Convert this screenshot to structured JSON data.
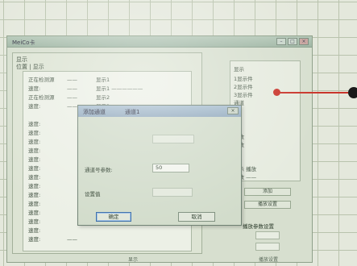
{
  "window": {
    "title": "MeiCo卡",
    "controls": [
      "–",
      "□",
      "×"
    ]
  },
  "left_panel": {
    "header": "显示",
    "subheader": "位置 | 显示",
    "rows": [
      {
        "key": "正在检测源",
        "val": "——",
        "num": "显示1"
      },
      {
        "key": "速度:",
        "val": "——",
        "num": "显示1 ——————"
      },
      {
        "key": "正在检测源",
        "val": "——",
        "num": "显示2"
      },
      {
        "key": "速度:",
        "val": "——",
        "num": "显示2"
      },
      {
        "key": "",
        "val": "",
        "num": ""
      },
      {
        "key": "速度:",
        "val": "",
        "num": ""
      },
      {
        "key": "速度:",
        "val": "",
        "num": ""
      },
      {
        "key": "速度:",
        "val": "",
        "num": ""
      },
      {
        "key": "速度:",
        "val": "",
        "num": ""
      },
      {
        "key": "速度:",
        "val": "",
        "num": ""
      },
      {
        "key": "速度:",
        "val": "",
        "num": ""
      },
      {
        "key": "速度:",
        "val": "",
        "num": ""
      },
      {
        "key": "速度:",
        "val": "",
        "num": ""
      },
      {
        "key": "速度:",
        "val": "",
        "num": ""
      },
      {
        "key": "速度:",
        "val": "",
        "num": ""
      },
      {
        "key": "速度:",
        "val": "",
        "num": ""
      },
      {
        "key": "速度:",
        "val": "",
        "num": ""
      },
      {
        "key": "速度:",
        "val": "",
        "num": ""
      },
      {
        "key": "速度:",
        "val": "——",
        "num": ""
      }
    ]
  },
  "right_panel": {
    "list": [
      "显示",
      "1显示件",
      "2显示件",
      "3显示件",
      "通道"
    ],
    "labels": [
      "播放",
      "播放"
    ],
    "options": [
      "显示 播放",
      "播放 ——"
    ],
    "buttons": [
      "添加",
      "播放设置"
    ],
    "section": "播放参数设置",
    "spinners": [
      "",
      ""
    ]
  },
  "dialog": {
    "title": "添加通道",
    "title2": "通道1",
    "close": "×",
    "row1_value": "",
    "row2_label": "通道号参数:",
    "row2_value": "50",
    "row3_label": "设置值",
    "row3_value": "",
    "ok_label": "确定",
    "cancel_label": "取消"
  },
  "status": {
    "left": "显示",
    "right": "播放设置"
  }
}
